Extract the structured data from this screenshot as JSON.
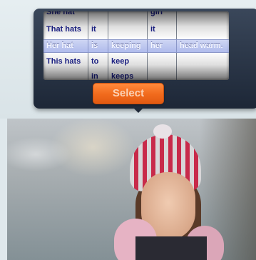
{
  "picker": {
    "columns": [
      {
        "rows": [
          "She hat",
          "That hats",
          "",
          "This hats",
          ""
        ]
      },
      {
        "rows": [
          "",
          "it",
          "",
          "to",
          "in"
        ]
      },
      {
        "rows": [
          "",
          "",
          "",
          "keep",
          "keeps"
        ]
      },
      {
        "rows": [
          "girl",
          "it",
          "",
          "",
          ""
        ]
      },
      {
        "rows": [
          "",
          "",
          "",
          "",
          ""
        ]
      }
    ],
    "selected": [
      "Her hat",
      "is",
      "keeping",
      "her",
      "head warm."
    ]
  },
  "select_button": {
    "label": "Select"
  },
  "colors": {
    "button": "#f06a1c",
    "panel": "#1d2737",
    "text": "#1a1f8c"
  }
}
